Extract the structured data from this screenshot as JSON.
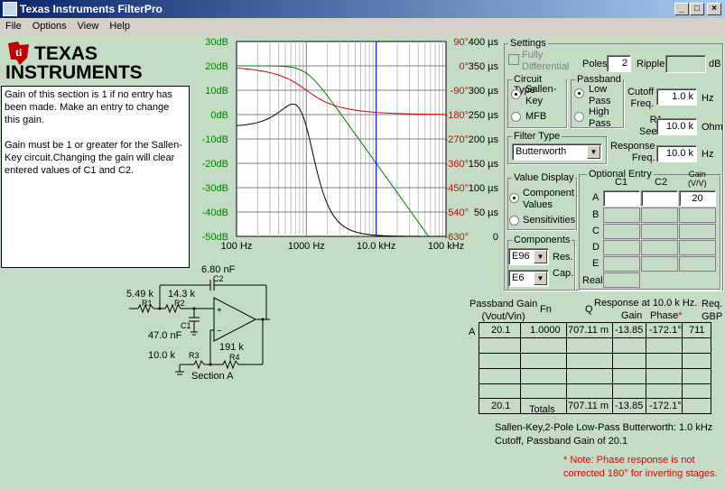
{
  "window": {
    "title": "Texas Instruments FilterPro"
  },
  "menu": [
    "File",
    "Options",
    "View",
    "Help"
  ],
  "logo": {
    "line1": "TEXAS",
    "line2": "INSTRUMENTS"
  },
  "message": "Gain of this section is 1 if no entry has been made. Make an entry to change this gain.\n\nGain must be 1 or greater for the Sallen-Key circuit.Changing the gain will clear entered values of C1 and C2.",
  "plot": {
    "gain_ticks": [
      "30dB",
      "20dB",
      "10dB",
      "0dB",
      "-10dB",
      "-20dB",
      "-30dB",
      "-40dB",
      "-50dB"
    ],
    "phase_ticks": [
      "90°",
      "0°",
      "-90°",
      "-180°",
      "-270°",
      "-360°",
      "-450°",
      "-540°",
      "-630°"
    ],
    "delay_ticks": [
      "400 µs",
      "350 µs",
      "300 µs",
      "250 µs",
      "200 µs",
      "150 µs",
      "100 µs",
      "50 µs",
      "0"
    ],
    "freq_ticks": [
      "100 Hz",
      "1000 Hz",
      "10.0 kHz",
      "100 kHz"
    ],
    "colors": {
      "gain": "#008000",
      "phase": "#e00000",
      "delay": "#000000",
      "marker": "#0000ff"
    }
  },
  "schematic": {
    "c2": "6.80 nF",
    "c2_name": "C2",
    "r1_val": "5.49 k",
    "r1_name": "R1",
    "r2_val": "14.3 k",
    "r2_name": "R2",
    "c1_name": "C1",
    "c1_val": "47.0 nF",
    "r4_val": "191 k",
    "r3_val": "10.0 k",
    "r3_name": "R3",
    "r4_name": "R4",
    "section": "Section A"
  },
  "settings": {
    "title": "Settings",
    "fully_differential": "Fully\nDifferential",
    "poles_label": "Poles",
    "poles": "2",
    "ripple_label": "Ripple",
    "ripple": "",
    "ripple_unit": "dB",
    "circuit_type": {
      "title": "Circuit Type",
      "opt1": "Sallen-\nKey",
      "opt2": "MFB"
    },
    "passband": {
      "title": "Passband",
      "opt1": "Low\nPass",
      "opt2": "High\nPass"
    },
    "cutoff_label": "Cutoff\nFreq.",
    "cutoff": "1.0 k",
    "cutoff_unit": "Hz",
    "seed_label": "R1\nSeed",
    "seed": "10.0 k",
    "seed_unit": "Ohm",
    "response_label": "Response\nFreq.",
    "response": "10.0 k",
    "response_unit": "Hz",
    "filter_type": {
      "title": "Filter Type",
      "value": "Butterworth"
    },
    "value_display": {
      "title": "Value Display",
      "opt1": "Component\nValues",
      "opt2": "Sensitivities"
    },
    "components": {
      "title": "Components",
      "res": "E96",
      "res_label": "Res.",
      "cap": "E6",
      "cap_label": "Cap."
    },
    "optional_entry": {
      "title": "Optional Entry",
      "col1": "C1",
      "col2": "C2",
      "col3": "Gain\n(V/V)",
      "rows": [
        "A",
        "B",
        "C",
        "D",
        "E",
        "Real"
      ],
      "gain_a": "20"
    }
  },
  "results": {
    "h_pgain": "Passband Gain\n(Vout/Vin)",
    "h_fn": "Fn",
    "h_q": "Q",
    "h_resp": "Response at 10.0 k Hz.",
    "h_gain": "Gain",
    "h_phase": "Phase",
    "h_star": "*",
    "h_req": "Req.\nGBP",
    "row_label": "A",
    "row": {
      "pgain": "20.1",
      "fn": "1.0000",
      "q": "707.11 m",
      "gain": "-13.85",
      "phase": "-172.1°",
      "gbp": "711"
    },
    "totals_label": "Totals",
    "totals": {
      "pgain": "20.1",
      "q": "707.11 m",
      "gain": "-13.85",
      "phase": "-172.1°"
    }
  },
  "summary": "Sallen-Key,2-Pole Low-Pass Butterworth: 1.0 kHz\nCutoff, Passband Gain of 20.1",
  "footnote": "* Note: Phase response is not\ncorrected 180° for inverting stages."
}
